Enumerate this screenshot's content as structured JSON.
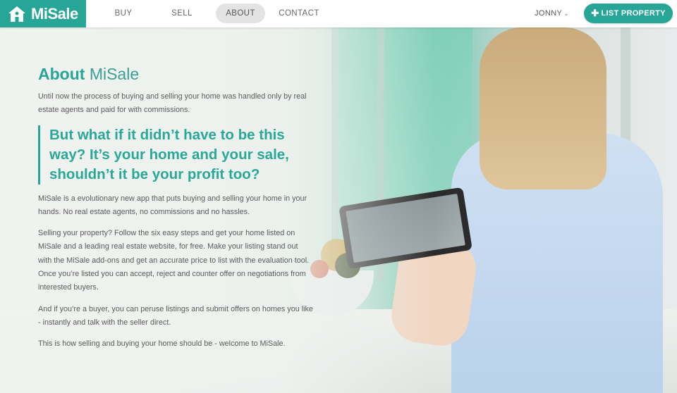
{
  "brand": {
    "name": "MiSale",
    "logo_icon": "house-icon",
    "color": "#27a596"
  },
  "nav": {
    "items": [
      {
        "label": "BUY",
        "active": false
      },
      {
        "label": "SELL",
        "active": false
      },
      {
        "label": "ABOUT",
        "active": true
      },
      {
        "label": "CONTACT",
        "active": false
      }
    ]
  },
  "user": {
    "name": "JONNY",
    "menu_icon": "chevron-down-icon"
  },
  "cta": {
    "label": "LIST PROPERTY",
    "icon": "plus-icon"
  },
  "page": {
    "title_strong": "About",
    "title_light": "MiSale",
    "intro": "Until now the process of buying and selling your home was handled only by real estate agents and paid for with commissions.",
    "quote": "But what if it didn’t have to be this way? It’s your home and your sale, shouldn’t it be your profit too?",
    "paragraphs": [
      "MiSale is a evolutionary new app that puts buying and selling your home in your hands. No real estate agents, no commissions and no hassles.",
      "Selling your property? Follow the six easy steps and get your home listed on MiSale and a leading real estate website, for free. Make your listing stand out with the MiSale add-ons and get an accurate price to list with the evaluation tool. Once you’re listed you can accept, reject and counter offer on negotiations from interested buyers.",
      "And if you’re a buyer, you can peruse listings and submit offers on homes you like - instantly and talk with the seller direct.",
      "This is how selling and buying your home should be - welcome to MiSale."
    ]
  }
}
